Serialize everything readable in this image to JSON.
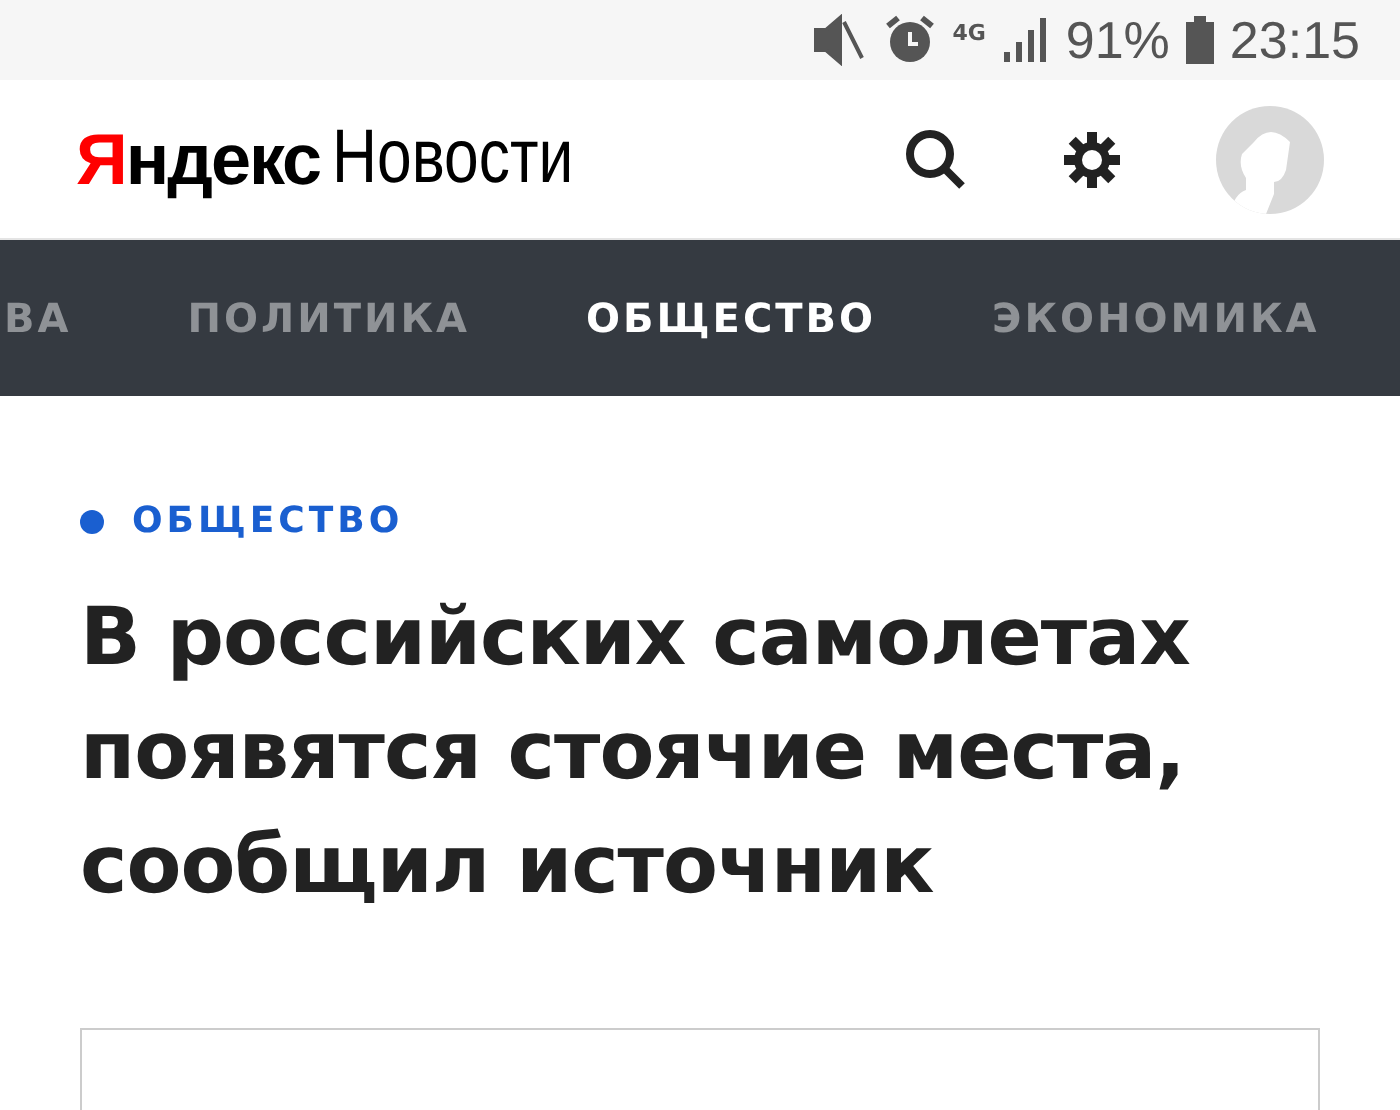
{
  "status_bar": {
    "battery": "91%",
    "time": "23:15",
    "network": "4G"
  },
  "header": {
    "brand": "Яндекс",
    "service": "Новости"
  },
  "nav_tabs": [
    {
      "label": "ВА",
      "selected": false
    },
    {
      "label": "ПОЛИТИКА",
      "selected": false
    },
    {
      "label": "ОБЩЕСТВО",
      "selected": true
    },
    {
      "label": "ЭКОНОМИКА",
      "selected": false
    }
  ],
  "article": {
    "category": "ОБЩЕСТВО",
    "title": "В российских самолетах появятся стоячие места, сообщил источник"
  }
}
